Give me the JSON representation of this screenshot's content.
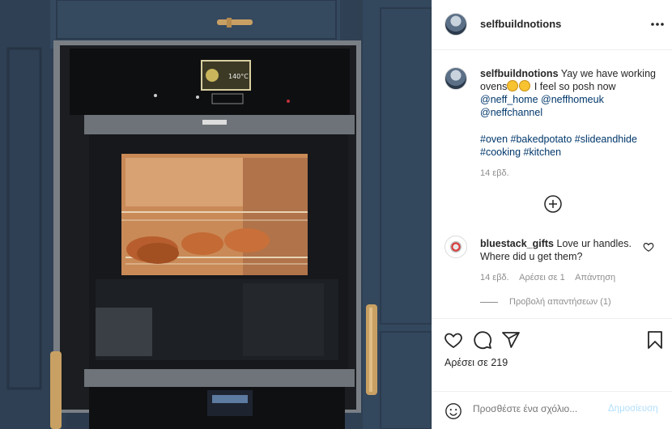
{
  "post": {
    "username": "selfbuildnotions",
    "caption": {
      "username": "selfbuildnotions",
      "text_before": "Yay we have working ovens",
      "text_after": " I feel so posh now",
      "mentions": [
        "@neff_home",
        "@neffhomeuk",
        "@neffchannel"
      ],
      "hashtags": "#oven #bakedpotato #slideandhide #cooking #kitchen",
      "time": "14 εβδ."
    },
    "comment": {
      "username": "bluestack_gifts",
      "text": "Love ur handles. Where did u get them?",
      "time": "14 εβδ.",
      "likes": "Αρέσει σε 1",
      "reply": "Απάντηση",
      "view_replies": "Προβολή απαντήσεων (1)"
    },
    "likes_text": "Αρέσει σε 219",
    "comment_placeholder": "Προσθέστε ένα σχόλιο...",
    "post_button": "Δημοσίευση"
  },
  "oven_display": {
    "top_screen": "140°C"
  },
  "icons": {
    "more": "more-horizontal-icon",
    "load_more": "plus-circle-icon",
    "heart": "heart-icon",
    "comment": "comment-icon",
    "share": "share-icon",
    "bookmark": "bookmark-icon",
    "emoji": "smile-icon"
  },
  "colors": {
    "mention": "#00376b",
    "muted": "#8e8e8e",
    "post_button_disabled": "#b2dffc"
  }
}
